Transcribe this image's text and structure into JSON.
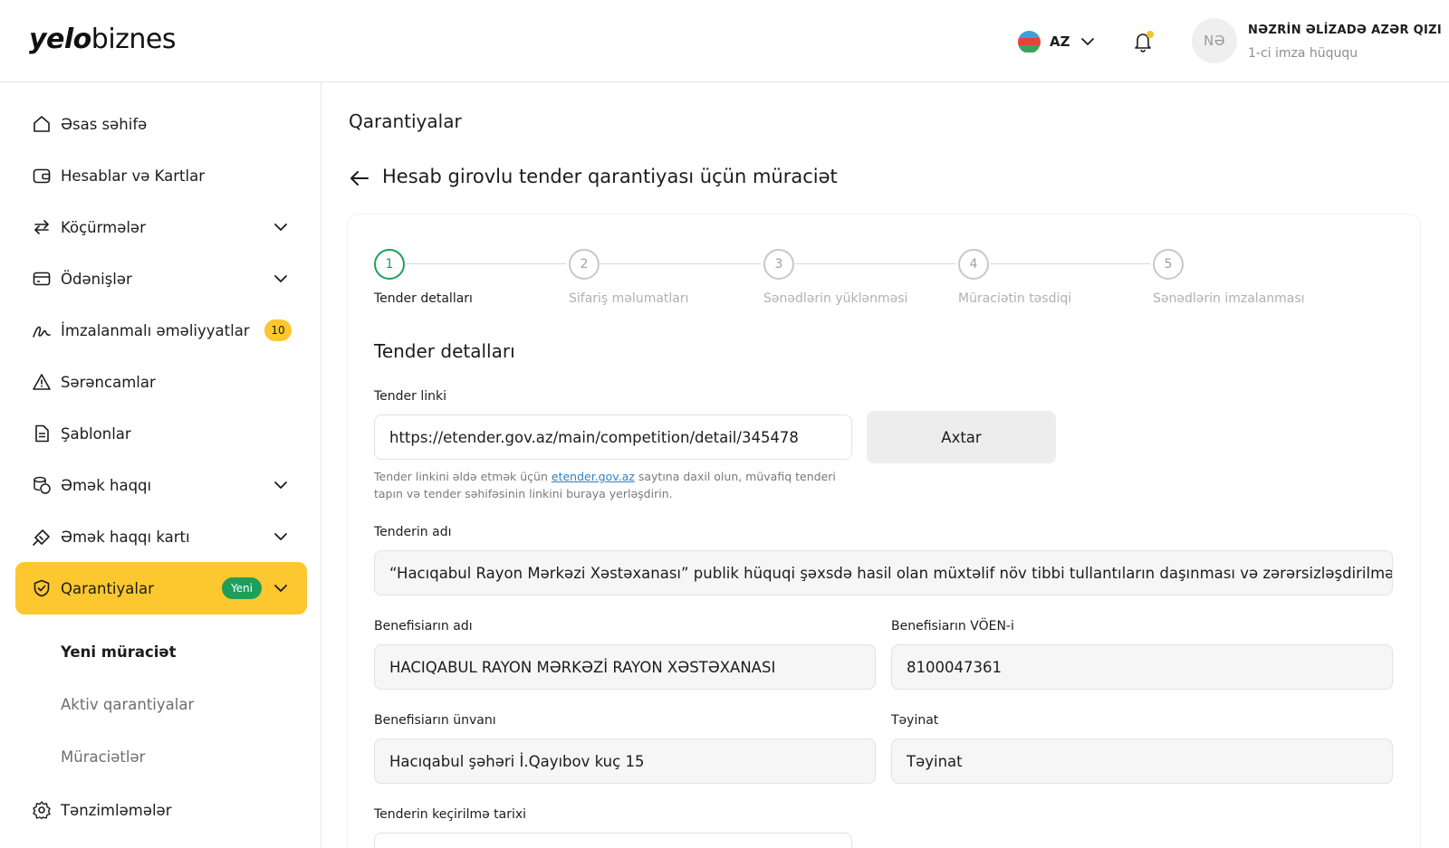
{
  "header": {
    "logo_bold": "yelo",
    "logo_regular": "biznes",
    "language": "AZ",
    "user_initials": "NƏ",
    "user_name": "NƏZRİN ƏLİZADƏ AZƏR QIZI",
    "user_role": "1-ci imza hüququ"
  },
  "sidebar": {
    "items": [
      {
        "label": "Əsas səhifə",
        "icon": "home-icon"
      },
      {
        "label": "Hesablar və Kartlar",
        "icon": "wallet-icon"
      },
      {
        "label": "Köçürmələr",
        "icon": "transfer-icon"
      },
      {
        "label": "Ödənişlər",
        "icon": "card-icon"
      },
      {
        "label": "İmzalanmalı əməliyyatlar",
        "icon": "signature-icon",
        "badge": "10"
      },
      {
        "label": "Sərəncamlar",
        "icon": "warning-icon"
      },
      {
        "label": "Şablonlar",
        "icon": "document-icon"
      },
      {
        "label": "Əmək haqqı",
        "icon": "coins-icon"
      },
      {
        "label": "Əmək haqqı kartı",
        "icon": "salary-card-icon"
      },
      {
        "label": "Qarantiyalar",
        "icon": "shield-check-icon",
        "badge": "Yeni"
      },
      {
        "label": "Tənzimləmələr",
        "icon": "gear-icon"
      }
    ],
    "sub_items": [
      "Yeni müraciət",
      "Aktiv qarantiyalar",
      "Müraciətlər"
    ]
  },
  "main": {
    "page_title": "Qarantiyalar",
    "subtitle": "Hesab girovlu tender qarantiyası üçün müraciət"
  },
  "stepper": {
    "steps": [
      {
        "number": "1",
        "label": "Tender detalları"
      },
      {
        "number": "2",
        "label": "Sifariş məlumatları"
      },
      {
        "number": "3",
        "label": "Sənədlərin yüklənməsi"
      },
      {
        "number": "4",
        "label": "Müraciətin təsdiqi"
      },
      {
        "number": "5",
        "label": "Sənədlərin imzalanması"
      }
    ],
    "active_step": 1
  },
  "form": {
    "section_title": "Tender detalları",
    "tender_link_label": "Tender linki",
    "tender_link_value": "https://etender.gov.az/main/competition/detail/345478",
    "search_button": "Axtar",
    "hint_before": "Tender linkini əldə etmək üçün",
    "hint_link": "etender.gov.az",
    "hint_after": "saytına daxil olun, müvafiq tenderi tapın və tender səhifəsinin linkini buraya yerləşdirin.",
    "tender_name_label": "Tenderin adı",
    "tender_name_value": "“Hacıqabul Rayon Mərkəzi Xəstəxanası” publik hüquqi şəxsdə hasil olan müxtəlif növ tibbi tullantıların daşınması və zərərsizləşdirilməsi",
    "beneficiary_name_label": "Benefisiarın adı",
    "beneficiary_name_value": "HACIQABUL RAYON MƏRKƏZİ RAYON XƏSTƏXANASI",
    "beneficiary_voen_label": "Benefisiarın VÖEN-i",
    "beneficiary_voen_value": "8100047361",
    "beneficiary_address_label": "Benefisiarın ünvanı",
    "beneficiary_address_value": "Hacıqabul şəhəri İ.Qayıbov kuç 15",
    "purpose_label": "Təyinat",
    "purpose_value": "Təyinat",
    "tender_date_label": "Tenderin keçirilmə tarixi"
  },
  "colors": {
    "accent_yellow": "#fcc72f",
    "active_green": "#1e9e5a",
    "link_blue": "#2f80c8"
  }
}
